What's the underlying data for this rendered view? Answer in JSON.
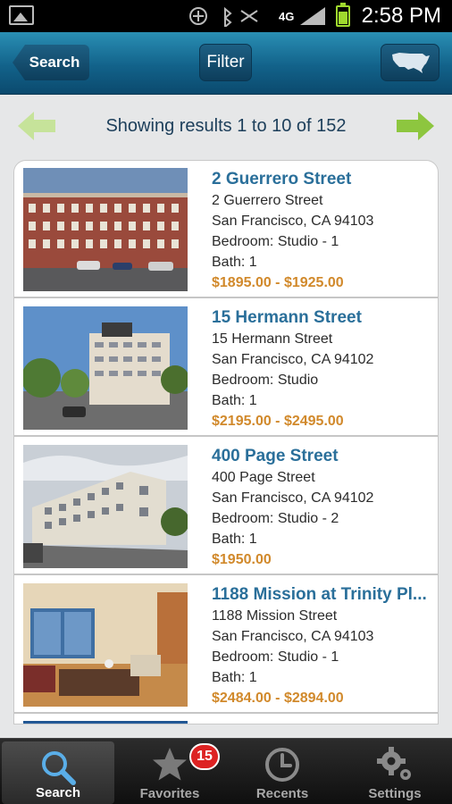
{
  "status_bar": {
    "time": "2:58 PM",
    "network": "4G"
  },
  "nav": {
    "back_label": "Search",
    "filter_label": "Filter",
    "map_icon": "usa-map-icon"
  },
  "pager": {
    "text": "Showing results 1 to 10 of 152"
  },
  "colors": {
    "nav_top": "#2a8fb4",
    "title": "#2a6f9a",
    "price": "#d1892b",
    "arrow": "#8dc63f"
  },
  "listings": [
    {
      "title": "2 Guerrero Street",
      "address": "2 Guerrero Street",
      "city": "San Francisco, CA 94103",
      "bedroom": "Bedroom: Studio - 1",
      "bath": "Bath: 1",
      "price": "$1895.00 - $1925.00"
    },
    {
      "title": "15 Hermann Street",
      "address": "15 Hermann Street",
      "city": "San Francisco, CA 94102",
      "bedroom": "Bedroom: Studio",
      "bath": "Bath: 1",
      "price": "$2195.00 - $2495.00"
    },
    {
      "title": "400 Page Street",
      "address": "400 Page Street",
      "city": "San Francisco, CA 94102",
      "bedroom": "Bedroom: Studio - 2",
      "bath": "Bath: 1",
      "price": "$1950.00"
    },
    {
      "title": "1188 Mission at Trinity Pl...",
      "address": "1188 Mission Street",
      "city": "San Francisco, CA 94103",
      "bedroom": "Bedroom: Studio - 1",
      "bath": "Bath: 1",
      "price": "$2484.00 - $2894.00"
    }
  ],
  "tabs": [
    {
      "label": "Search",
      "icon": "search-icon",
      "active": true
    },
    {
      "label": "Favorites",
      "icon": "star-icon",
      "badge": "15"
    },
    {
      "label": "Recents",
      "icon": "clock-icon"
    },
    {
      "label": "Settings",
      "icon": "gear-icon"
    }
  ]
}
